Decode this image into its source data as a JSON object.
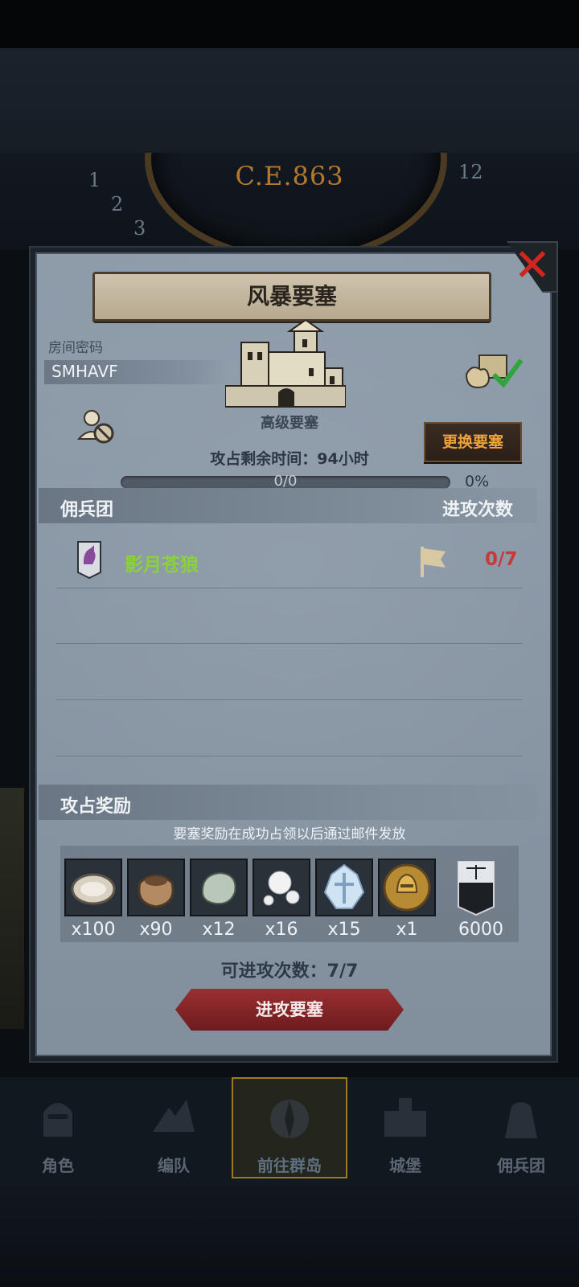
{
  "era_label": "C.E.863",
  "dial_numbers": [
    "1",
    "2",
    "3",
    "12"
  ],
  "panel": {
    "title": "风暴要塞",
    "close_icon": "close-x-icon",
    "room_label": "房间密码",
    "room_code": "SMHAVF",
    "fortress_type": "高级要塞",
    "change_fortress_button": "更换要塞",
    "remaining_time_text": "攻占剩余时间：94小时",
    "progress": {
      "text": "0/0",
      "percent_text": "0%",
      "fraction": 0
    },
    "mercenary_section": {
      "title": "佣兵团",
      "right_title": "进攻次数",
      "rows": [
        {
          "emblem": "wolf-emblem-icon",
          "name": "影月苍狼",
          "flag_icon": "flag-icon",
          "attacks": "0/7"
        }
      ]
    },
    "reward_section": {
      "title": "攻占奖励",
      "note": "要塞奖励在成功占领以后通过邮件发放",
      "items": [
        {
          "icon": "oyster-icon",
          "qty": "x100"
        },
        {
          "icon": "sack-icon",
          "qty": "x90"
        },
        {
          "icon": "jade-stone-icon",
          "qty": "x12"
        },
        {
          "icon": "pearls-icon",
          "qty": "x16"
        },
        {
          "icon": "crystal-icon",
          "qty": "x15"
        },
        {
          "icon": "gold-helmet-medal-icon",
          "qty": "x1"
        },
        {
          "icon": "justice-banner-icon",
          "qty": "6000"
        }
      ]
    },
    "attack_count_text": "可进攻次数：7/7",
    "attack_button": "进攻要塞"
  },
  "bottom_nav": [
    {
      "label": "角色",
      "icon": "knight-helmet-icon",
      "active": false
    },
    {
      "label": "编队",
      "icon": "formation-icon",
      "active": false
    },
    {
      "label": "前往群岛",
      "icon": "compass-map-icon",
      "active": true
    },
    {
      "label": "城堡",
      "icon": "castle-icon",
      "active": false
    },
    {
      "label": "佣兵团",
      "icon": "mercenary-icon",
      "active": false
    }
  ],
  "colors": {
    "panel_bg": "#8a98a7",
    "title_banner": "#cfc3ad",
    "accent_orange": "#f0a33b",
    "merc_green": "#8ad23a",
    "attack_red": "#c83a3a",
    "close_red": "#d0261d"
  }
}
